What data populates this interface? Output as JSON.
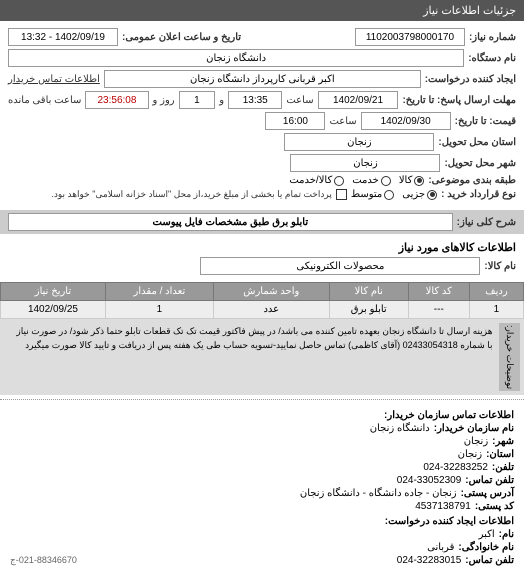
{
  "header": {
    "title": "جزئیات اطلاعات نیاز"
  },
  "form": {
    "request_no_label": "شماره نیاز:",
    "request_no": "1102003798000170",
    "public_announce_label": "تاریخ و ساعت اعلان عمومی:",
    "public_announce": "1402/09/19 - 13:32",
    "org_label": "نام دستگاه:",
    "org": "دانشگاه زنجان",
    "creator_label": "ایجاد کننده درخواست:",
    "creator": "اکبر قربانی کارپرداز دانشگاه زنجان",
    "buyer_contact_label": "اطلاعات تماس خریدار",
    "deadline_label": "مهلت ارسال پاسخ: تا تاریخ:",
    "deadline_date": "1402/09/21",
    "time_label": "ساعت",
    "deadline_time": "13:35",
    "and_label": "و",
    "days_remain": "1",
    "days_remain_label": "روز و",
    "countdown": "23:56:08",
    "countdown_label": "ساعت باقی مانده",
    "price_label": "قیمت: تا تاریخ:",
    "price_date": "1402/09/30",
    "price_time": "16:00",
    "province_label": "استان محل تحویل:",
    "province": "زنجان",
    "city_label": "شهر محل تحویل:",
    "city": "زنجان",
    "category_label": "طبقه بندی موضوعی:",
    "cat_goods": "کالا",
    "cat_service": "خدمت",
    "cat_goods_service": "کالا/خدمت",
    "contract_label": "نوع قرارداد خرید :",
    "contract_minor": "جزیی",
    "contract_medium": "متوسط",
    "full_payment_label": "پرداخت تمام یا بخشی از مبلغ خرید،از محل \"اسناد خزانه اسلامی\" خواهد بود.",
    "need_title_label": "شرح کلی نیاز:",
    "need_title": "تابلو برق طبق مشخصات فایل پیوست"
  },
  "section_goods": "اطلاعات کالاهای مورد نیاز",
  "goods_form": {
    "name_label": "نام کالا:",
    "name": "محصولات الکترونیکی"
  },
  "table": {
    "headers": [
      "ردیف",
      "کد کالا",
      "نام کالا",
      "واحد شمارش",
      "تعداد / مقدار",
      "تاریخ نیاز"
    ],
    "rows": [
      {
        "no": "1",
        "code": "---",
        "name": "تابلو برق",
        "unit": "عدد",
        "qty": "1",
        "date": "1402/09/25"
      }
    ]
  },
  "description": {
    "label": "توضیحات خریدار:",
    "text": "هزینه ارسال تا دانشگاه زنجان بعهده تامین کننده می باشد/ در پیش فاکتور قیمت تک تک قطعات تابلو حتما ذکر شود/ در صورت نیاز با شماره 02433054318 (آقای کاظمی) تماس حاصل نمایید-تسویه حساب طی یک هفته پس از دریافت و تایید کالا صورت میگیرد"
  },
  "contact": {
    "section_title": "اطلاعات تماس سازمان خریدار:",
    "org_label": "نام سازمان خریدار:",
    "org": "دانشگاه زنجان",
    "city_label": "شهر:",
    "city": "زنجان",
    "province_label": "استان:",
    "province": "زنجان",
    "phone_label": "تلفن:",
    "phone": "024-32283252",
    "fax_label": "تلفن تماس:",
    "fax": "024-33052309",
    "address_label": "آدرس پستی:",
    "address": "زنجان - جاده دانشگاه - دانشگاه زنجان",
    "postal_label": "کد پستی:",
    "postal": "4537138791",
    "creator_section": "اطلاعات ایجاد کننده درخواست:",
    "name_label": "نام:",
    "name": "اکبر",
    "family_label": "نام خانوادگی:",
    "family": "قربانی",
    "contact_phone_label": "تلفن تماس:",
    "contact_phone": "024-32283015",
    "footer_code": "021-88346670-ج"
  }
}
